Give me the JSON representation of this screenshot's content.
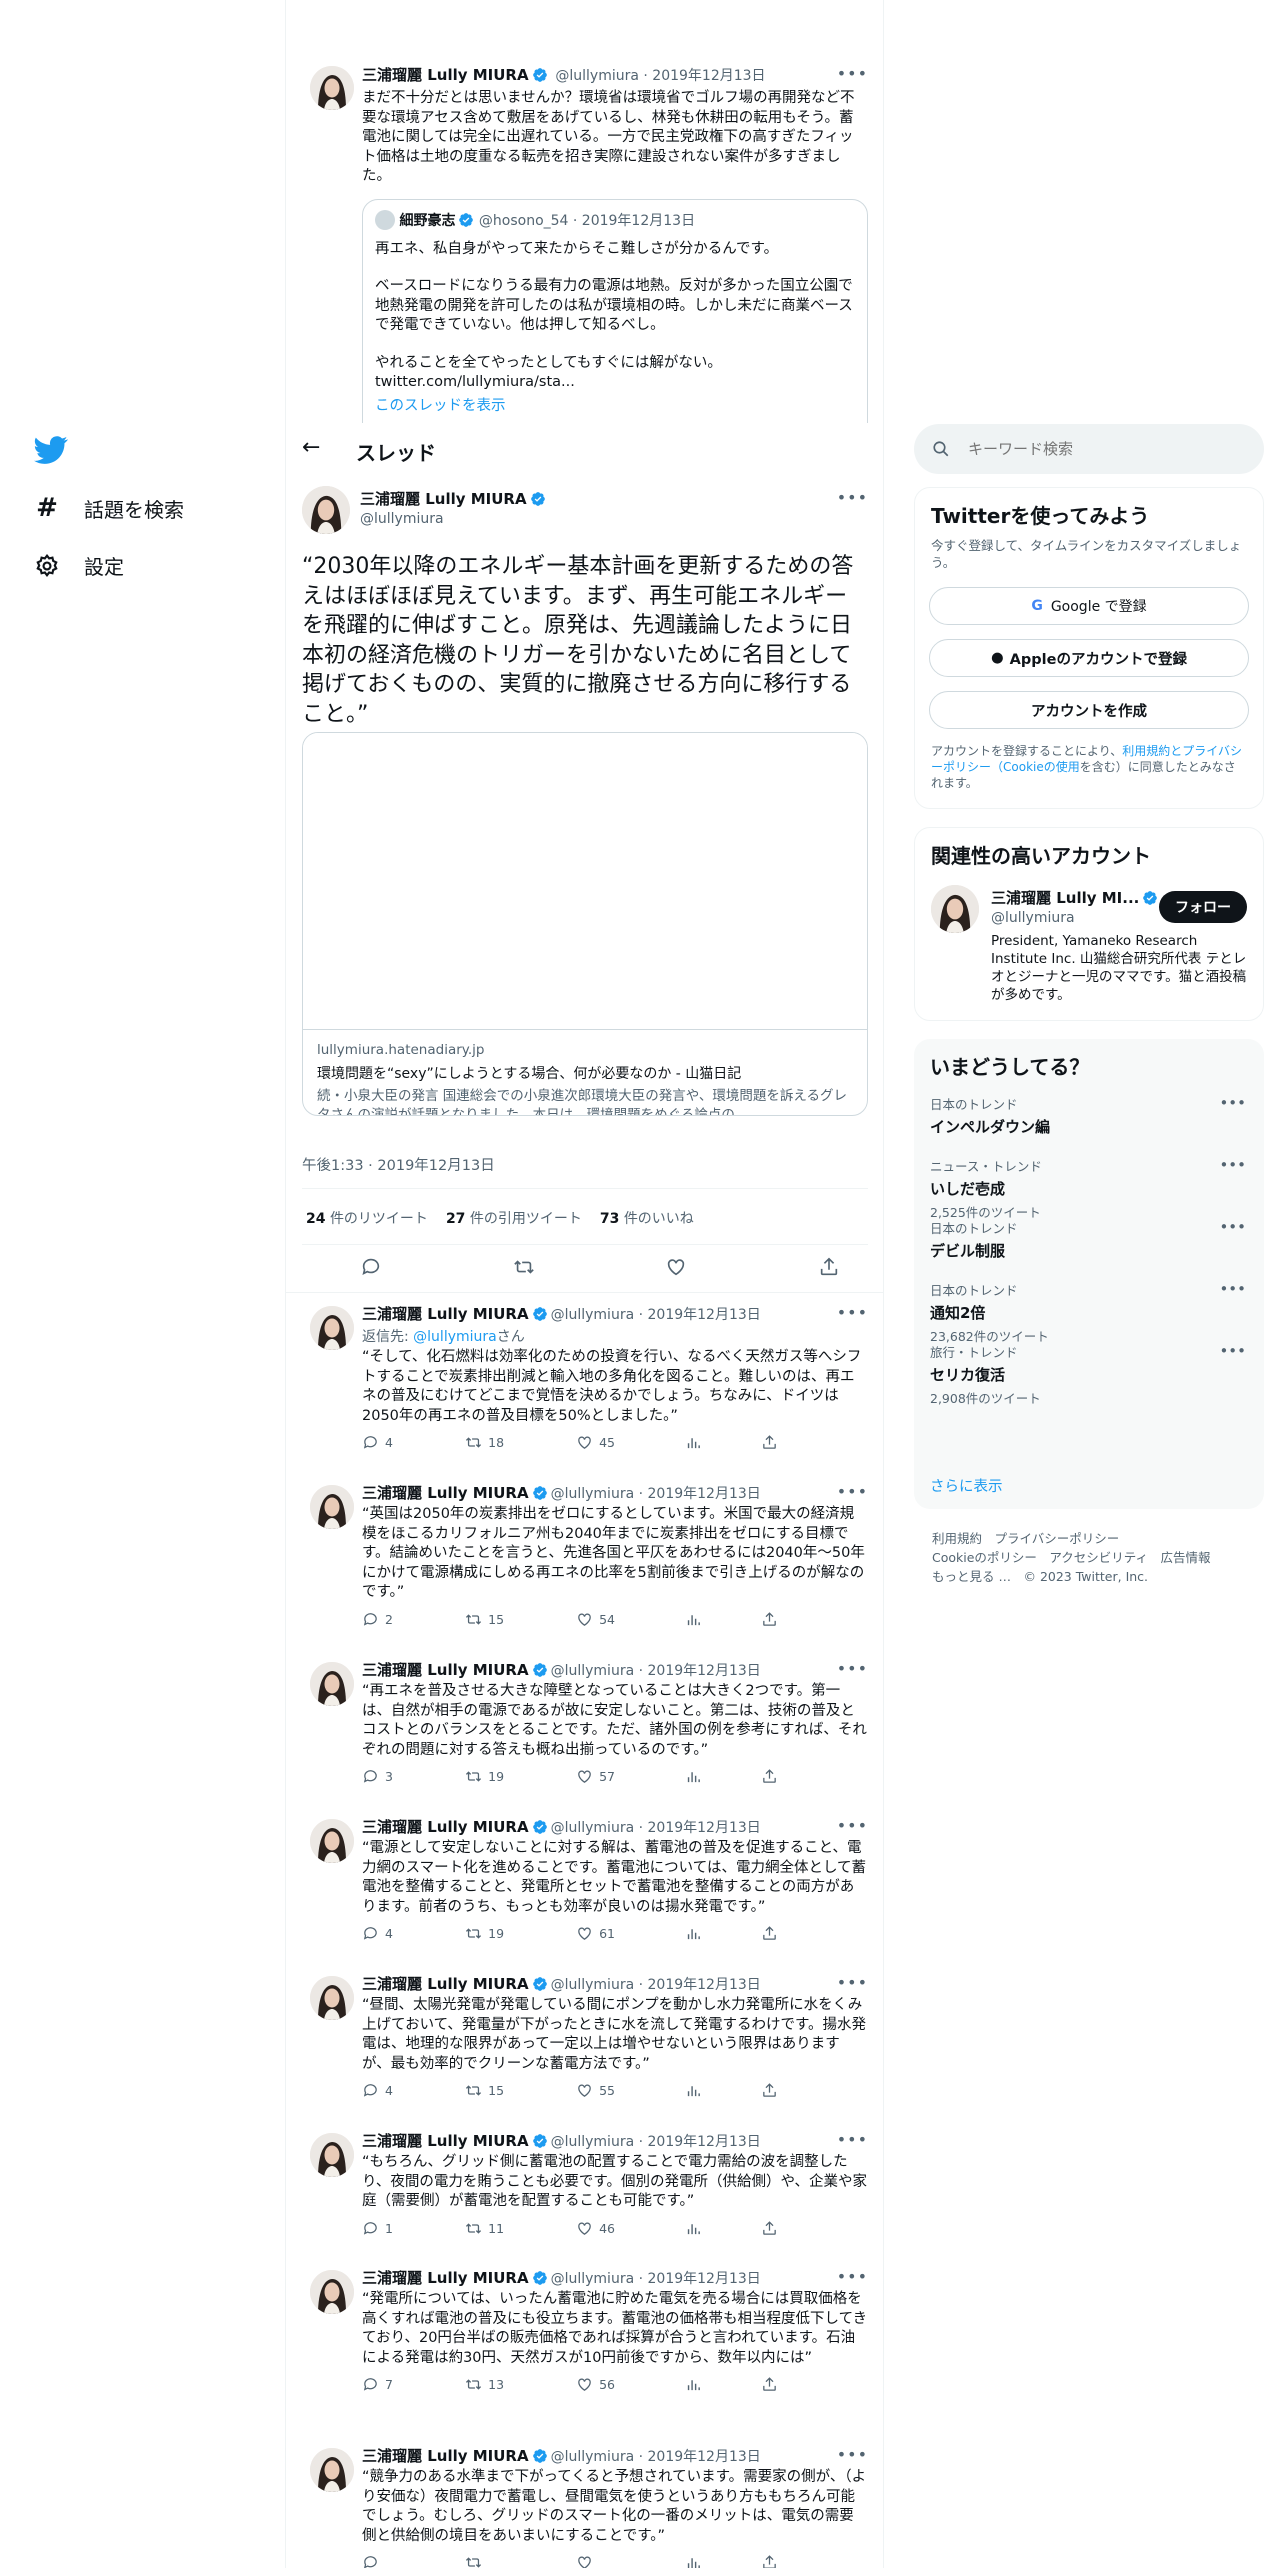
{
  "nav": {
    "explore_label": "話題を検索",
    "settings_label": "設定"
  },
  "top_tweet": {
    "name": "三浦瑠麗 Lully MIURA",
    "handle_time": "@lullymiura · 2019年12月13日",
    "text": "まだ不十分だとは思いませんか？環境省は環境省でゴルフ場の再開発など不要な環境アセス含めて敷居をあげているし、林発も休耕田の転用もそう。蓄電池に関しては完全に出遅れている。一方で民主党政権下の高すぎたフィット価格は土地の度重なる転売を招き実際に建設されない案件が多すぎました。",
    "quote": {
      "name": "細野豪志",
      "handle_time": "@hosono_54 · 2019年12月13日",
      "text1": "再エネ、私自身がやって来たからそこ難しさが分かるんです。",
      "text2": "ベースロードになりうる最有力の電源は地熱。反対が多かった国立公園で地熱発電の開発を許可したのは私が環境相の時。しかし未だに商業ベースで発電できていない。他は押して知るべし。",
      "text3": "やれることを全てやったとしてもすぐには解がない。",
      "link": "twitter.com/lullymiura/sta...",
      "show_thread": "このスレッドを表示"
    }
  },
  "header": {
    "title": "スレッド"
  },
  "main_tweet": {
    "name": "三浦瑠麗 Lully MIURA",
    "handle": "@lullymiura",
    "text": "“2030年以降のエネルギー基本計画を更新するための答えはほぼほぼ見えています。まず、再生可能エネルギーを飛躍的に伸ばすこと。原発は、先週議論したように日本初の経済危機のトリガーを引かないために名目として掲げておくものの、実質的に撤廃させる方向に移行すること。”",
    "card": {
      "domain": "lullymiura.hatenadiary.jp",
      "title": "環境問題を“sexy”にしようとする場合、何が必要なのか - 山猫日記",
      "desc": "続・小泉大臣の発言 国連総会での小泉進次郎環境大臣の発言や、環境問題を訴えるグレタさんの演説が話題となりました。本日は、環境問題をめぐる論点の..."
    },
    "timestamp": "午後1:33 · 2019年12月13日",
    "stats": {
      "retweets": "24",
      "retweets_label": "件のリツイート",
      "quotes": "27",
      "quotes_label": "件の引用ツイート",
      "likes": "73",
      "likes_label": "件のいいね"
    }
  },
  "replies": [
    {
      "name": "三浦瑠麗 Lully MIURA",
      "handle_time": "@lullymiura · 2019年12月13日",
      "reply_to_prefix": "返信先: ",
      "reply_to_handle": "@lullymiura",
      "reply_to_suffix": "さん",
      "text": "“そして、化石燃料は効率化のための投資を行い、なるべく天然ガス等へシフトすることで炭素排出削減と輸入地の多角化を図ること。難しいのは、再エネの普及にむけてどこまで覚悟を決めるかでしょう。ちなみに、ドイツは2050年の再エネの普及目標を50%としました。”",
      "replies": "4",
      "retweets": "18",
      "likes": "45"
    },
    {
      "name": "三浦瑠麗 Lully MIURA",
      "handle_time": "@lullymiura · 2019年12月13日",
      "text": "“英国は2050年の炭素排出をゼロにするとしています。米国で最大の経済規模をほこるカリフォルニア州も2040年までに炭素排出をゼロにする目標です。結論めいたことを言うと、先進各国と平仄をあわせるには2040年～50年にかけて電源構成にしめる再エネの比率を5割前後まで引き上げるのが解なのです。”",
      "replies": "2",
      "retweets": "15",
      "likes": "54"
    },
    {
      "name": "三浦瑠麗 Lully MIURA",
      "handle_time": "@lullymiura · 2019年12月13日",
      "text": "“再エネを普及させる大きな障壁となっていることは大きく2つです。第一は、自然が相手の電源であるが故に安定しないこと。第二は、技術の普及とコストとのバランスをとることです。ただ、諸外国の例を参考にすれば、それぞれの問題に対する答えも概ね出揃っているのです。”",
      "replies": "3",
      "retweets": "19",
      "likes": "57"
    },
    {
      "name": "三浦瑠麗 Lully MIURA",
      "handle_time": "@lullymiura · 2019年12月13日",
      "text": "“電源として安定しないことに対する解は、蓄電池の普及を促進すること、電力網のスマート化を進めることです。蓄電池については、電力網全体として蓄電池を整備することと、発電所とセットで蓄電池を整備することの両方があります。前者のうち、もっとも効率が良いのは揚水発電です。”",
      "replies": "4",
      "retweets": "19",
      "likes": "61"
    },
    {
      "name": "三浦瑠麗 Lully MIURA",
      "handle_time": "@lullymiura · 2019年12月13日",
      "text": "“昼間、太陽光発電が発電している間にポンプを動かし水力発電所に水をくみ上げておいて、発電量が下がったときに水を流して発電するわけです。揚水発電は、地理的な限界があって一定以上は増やせないという限界はありますが、最も効率的でクリーンな蓄電方法です。”",
      "replies": "4",
      "retweets": "15",
      "likes": "55"
    },
    {
      "name": "三浦瑠麗 Lully MIURA",
      "handle_time": "@lullymiura · 2019年12月13日",
      "text": "“もちろん、グリッド側に蓄電池の配置することで電力需給の波を調整したり、夜間の電力を賄うことも必要です。個別の発電所（供給側）や、企業や家庭（需要側）が蓄電池を配置することも可能です。”",
      "replies": "1",
      "retweets": "11",
      "likes": "46"
    },
    {
      "name": "三浦瑠麗 Lully MIURA",
      "handle_time": "@lullymiura · 2019年12月13日",
      "text": "“発電所については、いったん蓄電池に貯めた電気を売る場合には買取価格を高くすれば電池の普及にも役立ちます。蓄電池の価格帯も相当程度低下してきており、20円台半ばの販売価格であれば採算が合うと言われています。石油による発電は約30円、天然ガスが10円前後ですから、数年以内には”",
      "replies": "7",
      "retweets": "13",
      "likes": "56"
    },
    {
      "name": "三浦瑠麗 Lully MIURA",
      "handle_time": "@lullymiura · 2019年12月13日",
      "text": "“競争力のある水準まで下がってくると予想されています。需要家の側が、（より安価な）夜間電力で蓄電し、昼間電気を使うというあり方ももちろん可能でしょう。むしろ、グリッドのスマート化の一番のメリットは、電気の需要側と供給側の境目をあいまいにすることです。”",
      "replies": "",
      "retweets": "",
      "likes": ""
    }
  ],
  "sidebar": {
    "search_placeholder": "キーワード検索",
    "signup": {
      "title": "Twitterを使ってみよう",
      "desc": "今すぐ登録して、タイムラインをカスタマイズしましょう。",
      "google_label": "Google で登録",
      "apple_label": "Appleのアカウントで登録",
      "create_label": "アカウントを作成",
      "terms_prefix": "アカウントを登録することにより、",
      "terms_link": "利用規約とプライバシーポリシー（Cookieの使用",
      "terms_suffix": "を含む）に同意したとみなされます。"
    },
    "related": {
      "title": "関連性の高いアカウント",
      "name": "三浦瑠麗 Lully MI...",
      "handle": "@lullymiura",
      "follow_label": "フォロー",
      "bio": "President, Yamaneko Research Institute Inc. 山猫総合研究所代表 テとレオとジーナと一児のママです。猫と酒投稿が多めです。"
    },
    "trends": {
      "title": "いまどうしてる？",
      "items": [
        {
          "category": "日本のトレンド",
          "name": "インペルダウン編",
          "count": ""
        },
        {
          "category": "ニュース・トレンド",
          "name": "いしだ壱成",
          "count": "2,525件のツイート"
        },
        {
          "category": "日本のトレンド",
          "name": "デビル制服",
          "count": ""
        },
        {
          "category": "日本のトレンド",
          "name": "通知2倍",
          "count": "23,682件のツイート"
        },
        {
          "category": "旅行・トレンド",
          "name": "セリカ復活",
          "count": "2,908件のツイート"
        }
      ],
      "show_more": "さらに表示"
    },
    "footer": {
      "line1": "利用規約　プライバシーポリシー",
      "line2": "Cookieのポリシー　アクセシビリティ　広告情報",
      "line3": "もっと見る …　© 2023 Twitter, Inc."
    }
  },
  "colors": {
    "accent": "#1d9bf0",
    "text": "#0f1419",
    "muted": "#536471",
    "border": "#eff3f4"
  }
}
